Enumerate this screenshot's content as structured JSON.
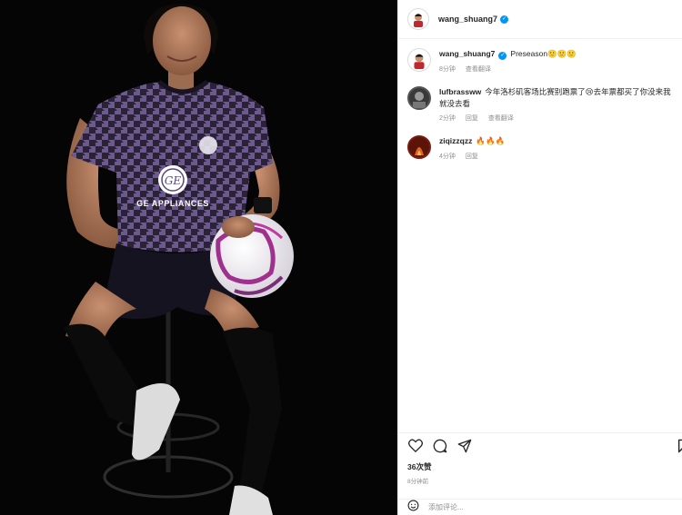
{
  "post": {
    "author": "wang_shuang7",
    "caption": "Preseason",
    "caption_emoji": "🙂🙂🙂",
    "caption_time": "8分钟",
    "translate_label": "查看翻译"
  },
  "comments": [
    {
      "user": "lufbrassww",
      "text": "今年洛杉矶客场比赛别跑票了😢去年票都买了你没来我就没去看",
      "time": "2分钟",
      "reply_label": "回复",
      "translate_label": "查看翻译"
    },
    {
      "user": "ziqizzqzz",
      "text": "🔥🔥🔥",
      "time": "4分钟",
      "reply_label": "回复"
    }
  ],
  "stats": {
    "likes": "36次赞",
    "posted": "8分钟前"
  },
  "composer": {
    "placeholder": "添加评论..."
  },
  "photo": {
    "jersey_sponsor": "GE APPLIANCES",
    "sponsor_logo": "GE"
  },
  "colors": {
    "verified": "#0095f6",
    "muted_text": "#8e8e8e",
    "jersey": "#5a4a7a"
  },
  "icons": {
    "like": "heart-icon",
    "comment": "comment-icon",
    "share": "share-icon",
    "save": "bookmark-icon",
    "emoji": "smiley-icon",
    "verified": "verified-badge-icon"
  }
}
